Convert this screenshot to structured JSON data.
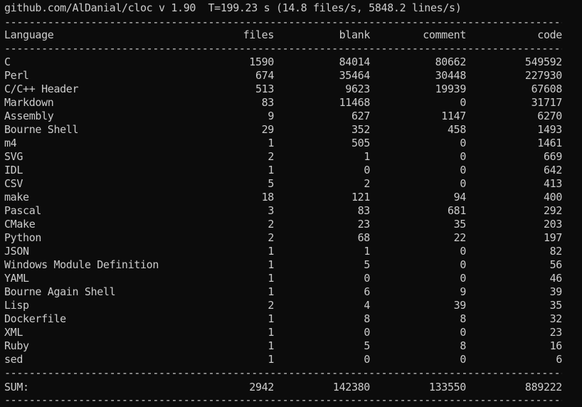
{
  "header": {
    "info_line": "github.com/AlDanial/cloc v 1.90  T=199.23 s (14.8 files/s, 5848.2 lines/s)"
  },
  "rule_char": "-",
  "table": {
    "columns": [
      "Language",
      "files",
      "blank",
      "comment",
      "code"
    ],
    "rows": [
      {
        "language": "C",
        "files": "1590",
        "blank": "84014",
        "comment": "80662",
        "code": "549592"
      },
      {
        "language": "Perl",
        "files": "674",
        "blank": "35464",
        "comment": "30448",
        "code": "227930"
      },
      {
        "language": "C/C++ Header",
        "files": "513",
        "blank": "9623",
        "comment": "19939",
        "code": "67608"
      },
      {
        "language": "Markdown",
        "files": "83",
        "blank": "11468",
        "comment": "0",
        "code": "31717"
      },
      {
        "language": "Assembly",
        "files": "9",
        "blank": "627",
        "comment": "1147",
        "code": "6270"
      },
      {
        "language": "Bourne Shell",
        "files": "29",
        "blank": "352",
        "comment": "458",
        "code": "1493"
      },
      {
        "language": "m4",
        "files": "1",
        "blank": "505",
        "comment": "0",
        "code": "1461"
      },
      {
        "language": "SVG",
        "files": "2",
        "blank": "1",
        "comment": "0",
        "code": "669"
      },
      {
        "language": "IDL",
        "files": "1",
        "blank": "0",
        "comment": "0",
        "code": "642"
      },
      {
        "language": "CSV",
        "files": "5",
        "blank": "2",
        "comment": "0",
        "code": "413"
      },
      {
        "language": "make",
        "files": "18",
        "blank": "121",
        "comment": "94",
        "code": "400"
      },
      {
        "language": "Pascal",
        "files": "3",
        "blank": "83",
        "comment": "681",
        "code": "292"
      },
      {
        "language": "CMake",
        "files": "2",
        "blank": "23",
        "comment": "35",
        "code": "203"
      },
      {
        "language": "Python",
        "files": "2",
        "blank": "68",
        "comment": "22",
        "code": "197"
      },
      {
        "language": "JSON",
        "files": "1",
        "blank": "1",
        "comment": "0",
        "code": "82"
      },
      {
        "language": "Windows Module Definition",
        "files": "1",
        "blank": "5",
        "comment": "0",
        "code": "56"
      },
      {
        "language": "YAML",
        "files": "1",
        "blank": "0",
        "comment": "0",
        "code": "46"
      },
      {
        "language": "Bourne Again Shell",
        "files": "1",
        "blank": "6",
        "comment": "9",
        "code": "39"
      },
      {
        "language": "Lisp",
        "files": "2",
        "blank": "4",
        "comment": "39",
        "code": "35"
      },
      {
        "language": "Dockerfile",
        "files": "1",
        "blank": "8",
        "comment": "8",
        "code": "32"
      },
      {
        "language": "XML",
        "files": "1",
        "blank": "0",
        "comment": "0",
        "code": "23"
      },
      {
        "language": "Ruby",
        "files": "1",
        "blank": "5",
        "comment": "8",
        "code": "16"
      },
      {
        "language": "sed",
        "files": "1",
        "blank": "0",
        "comment": "0",
        "code": "6"
      }
    ],
    "sum": {
      "label": "SUM:",
      "files": "2942",
      "blank": "142380",
      "comment": "133550",
      "code": "889222"
    }
  },
  "colors": {
    "background": "#0c0c0c",
    "text": "#cccccc"
  }
}
